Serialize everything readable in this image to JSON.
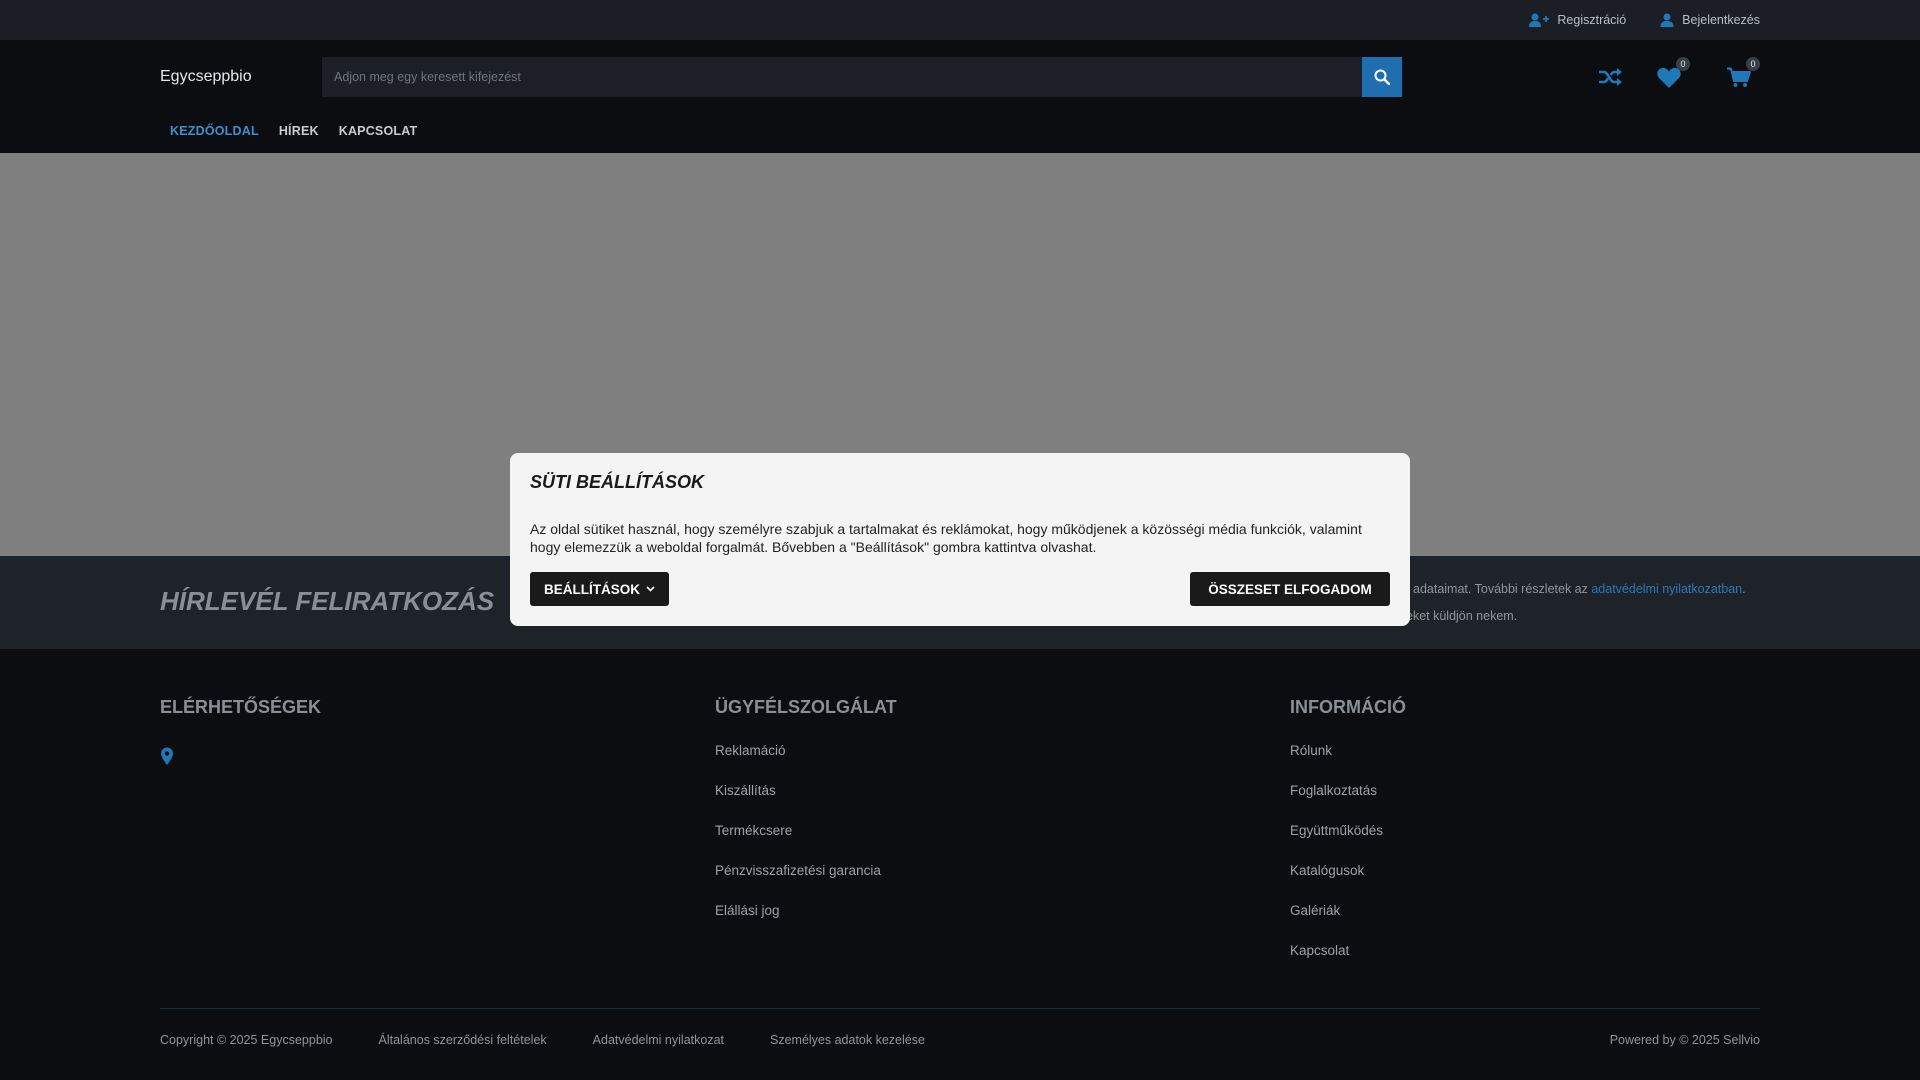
{
  "topbar": {
    "register_label": "Regisztráció",
    "login_label": "Bejelentkezés"
  },
  "header": {
    "logo": "Egycseppbio",
    "search_placeholder": "Adjon meg egy keresett kifejezést",
    "wishlist_count": "0",
    "cart_count": "0"
  },
  "nav": {
    "items": [
      "KEZDŐOLDAL",
      "HÍREK",
      "KAPCSOLAT"
    ]
  },
  "newsletter": {
    "title": "HÍRLEVÉL FELIRATKOZÁS",
    "text1_a": "adataimat. További részletek az ",
    "text1_link": "adatvédelmi nyilatkozatban",
    "text1_b": ".",
    "text2": "eket küldjön nekem."
  },
  "footer": {
    "contact_title": "ELÉRHETŐSÉGEK",
    "service_title": "ÜGYFÉLSZOLGÁLAT",
    "service_items": [
      "Reklamáció",
      "Kiszállítás",
      "Termékcsere",
      "Pénzvisszafizetési garancia",
      "Elállási jog"
    ],
    "info_title": "INFORMÁCIÓ",
    "info_items": [
      "Rólunk",
      "Foglalkoztatás",
      "Együttműködés",
      "Katalógusok",
      "Galériák",
      "Kapcsolat"
    ],
    "copyright": "Copyright © 2025 Egycseppbio",
    "bottom_links": [
      "Általános szerződési feltételek",
      "Adatvédelmi nyilatkozat",
      "Személyes adatok kezelése"
    ],
    "powered": "Powered by © 2025 Sellvio"
  },
  "cookie": {
    "title": "SÜTI BEÁLLÍTÁSOK",
    "text": "Az oldal sütiket használ, hogy személyre szabjuk a tartalmakat és reklámokat, hogy működjenek a közösségi média funkciók, valamint hogy elemezzük a weboldal forgalmát. Bővebben a \"Beállítások\" gombra kattintva olvashat.",
    "settings_label": "BEÁLLÍTÁSOK",
    "accept_label": "ÖSSZESET ELFOGADOM"
  },
  "colors": {
    "accent": "#1f6fb0",
    "nav_active": "#3f8fd0",
    "hero": "#7f7f7f"
  },
  "icons": [
    "user-plus-icon",
    "user-icon",
    "search-icon",
    "shuffle-icon",
    "heart-icon",
    "cart-icon",
    "map-pin-icon",
    "chevron-down-icon"
  ]
}
